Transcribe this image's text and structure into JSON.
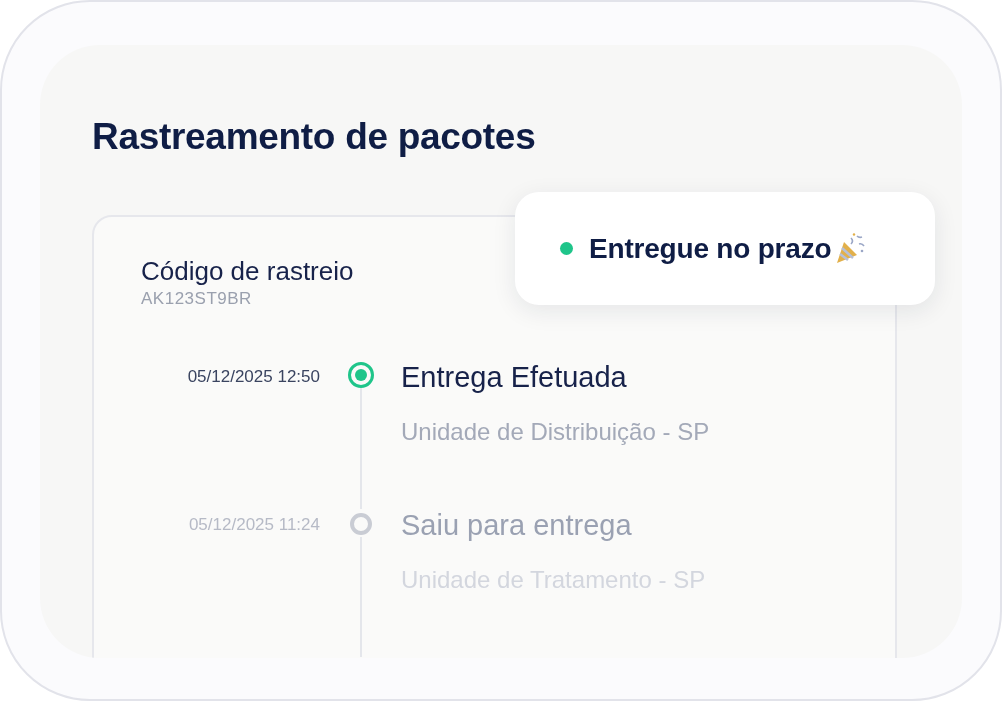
{
  "title": "Rastreamento de pacotes",
  "status_badge": {
    "label": "Entregue no prazo",
    "color": "#1fc58a"
  },
  "tracking": {
    "label": "Código de rastreio",
    "code": "AK123ST9BR"
  },
  "events": [
    {
      "datetime": "05/12/2025 12:50",
      "title": "Entrega Efetuada",
      "location": "Unidade de Distribuição - SP",
      "current": true
    },
    {
      "datetime": "05/12/2025 11:24",
      "title": "Saiu para entrega",
      "location": "Unidade de Tratamento - SP",
      "current": false
    }
  ]
}
